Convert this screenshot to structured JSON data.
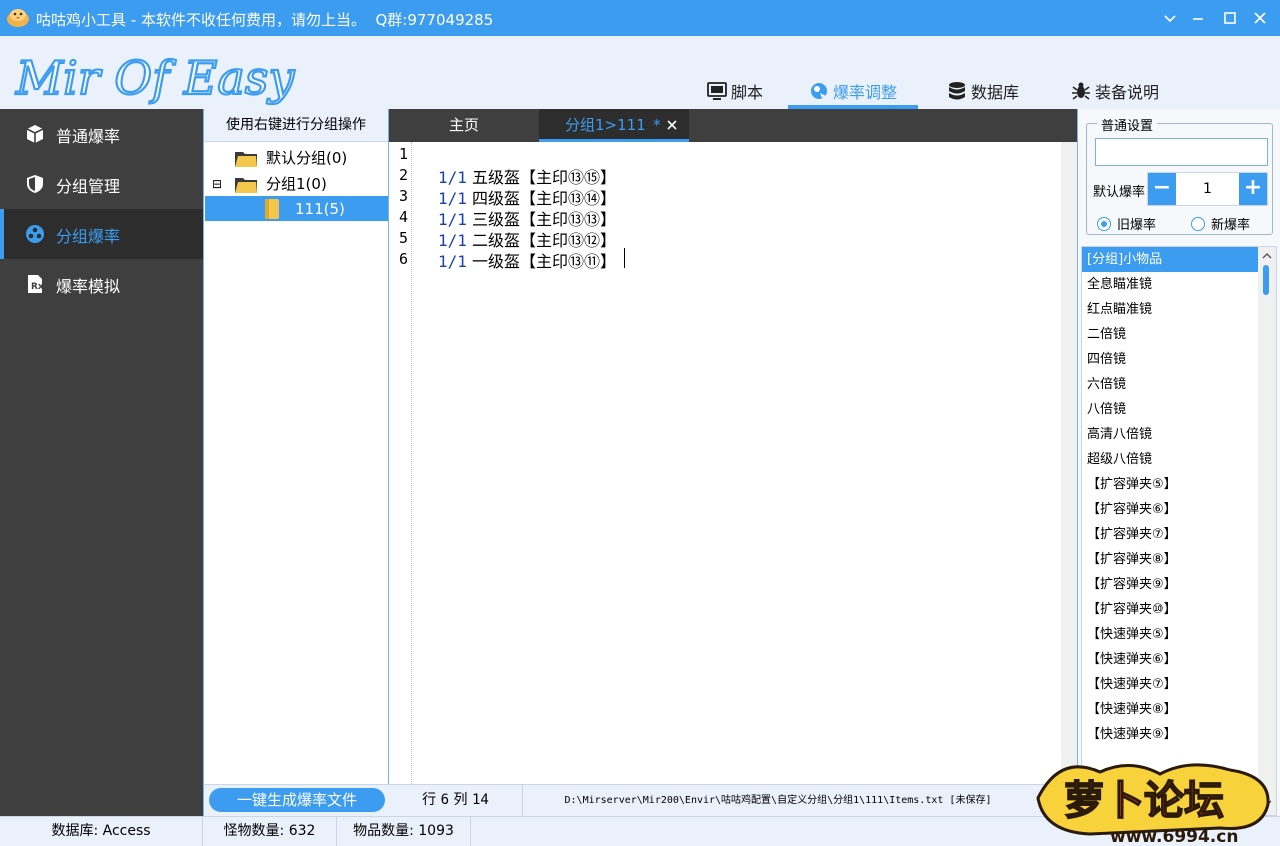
{
  "app": {
    "title": "咕咕鸡小工具 - 本软件不收任何费用，请勿上当。  Q群:977049285",
    "logo_text": "Mir Of Easy",
    "icon": "chick-icon"
  },
  "window_controls": {
    "minimize": "minimize-icon",
    "maximize": "maximize-icon",
    "close": "close-icon"
  },
  "top_tabs": [
    {
      "label": "脚本",
      "icon": "monitor-icon",
      "active": false
    },
    {
      "label": "爆率调整",
      "icon": "shield-ring-icon",
      "active": true
    },
    {
      "label": "数据库",
      "icon": "database-icon",
      "active": false
    },
    {
      "label": "装备说明",
      "icon": "bug-icon",
      "active": false
    }
  ],
  "left_nav": [
    {
      "label": "普通爆率",
      "icon": "cube-icon",
      "active": false
    },
    {
      "label": "分组管理",
      "icon": "shield-icon",
      "active": false
    },
    {
      "label": "分组爆率",
      "icon": "cluster-icon",
      "active": true
    },
    {
      "label": "爆率模拟",
      "icon": "prescription-icon",
      "active": false
    }
  ],
  "tree": {
    "header": "使用右键进行分组操作",
    "nodes": [
      {
        "label": "默认分组(0)",
        "expander": ""
      },
      {
        "label": "分组1(0)",
        "expander": "⊟"
      },
      {
        "label": "111(5)",
        "expander": ""
      }
    ]
  },
  "editor_tabs": [
    {
      "label": "主页",
      "active": false
    },
    {
      "label": "分组1>111",
      "modified": "*",
      "active": true
    }
  ],
  "editor": {
    "line_numbers": [
      "1",
      "2",
      "3",
      "4",
      "5",
      "6"
    ],
    "lines": [
      {
        "rate": "",
        "text": ""
      },
      {
        "rate": "1/1",
        "text": "五级盔【主印⑬⑮】"
      },
      {
        "rate": "1/1",
        "text": "四级盔【主印⑬⑭】"
      },
      {
        "rate": "1/1",
        "text": "三级盔【主印⑬⑬】"
      },
      {
        "rate": "1/1",
        "text": "二级盔【主印⑬⑫】"
      },
      {
        "rate": "1/1",
        "text": "一级盔【主印⑬⑪】"
      }
    ]
  },
  "settings": {
    "legend": "普通设置",
    "input_value": "",
    "default_rate_label": "默认爆率",
    "default_rate_value": "1",
    "minus": "−",
    "plus": "+",
    "radio_old": "旧爆率",
    "radio_new": "新爆率",
    "selected_radio": "old"
  },
  "item_list": [
    "[分组]小物品",
    "全息瞄准镜",
    "红点瞄准镜",
    "二倍镜",
    "四倍镜",
    "六倍镜",
    "八倍镜",
    "高清八倍镜",
    "超级八倍镜",
    "【扩容弹夹⑤】",
    "【扩容弹夹⑥】",
    "【扩容弹夹⑦】",
    "【扩容弹夹⑧】",
    "【扩容弹夹⑨】",
    "【扩容弹夹⑩】",
    "【快速弹夹⑤】",
    "【快速弹夹⑥】",
    "【快速弹夹⑦】",
    "【快速弹夹⑧】",
    "【快速弹夹⑨】"
  ],
  "bottom": {
    "generate_button": "一键生成爆率文件",
    "row_label": "行",
    "row_value": "6",
    "col_label": "列",
    "col_value": "14",
    "file_path": "D:\\Mirserver\\Mir200\\Envir\\咕咕鸡配置\\自定义分组\\分组1\\111\\Items.txt [未保存]"
  },
  "statusbar": {
    "database": "数据库: Access",
    "monster_count": "怪物数量: 632",
    "item_count": "物品数量: 1093"
  },
  "watermark": {
    "text": "萝卜论坛",
    "url": "www.6994.cn"
  },
  "colors": {
    "accent": "#3c9cf0",
    "nav_bg": "#3f3f3f",
    "nav_active_bg": "#2d2d2d",
    "header_bg": "#eaf1fb"
  }
}
